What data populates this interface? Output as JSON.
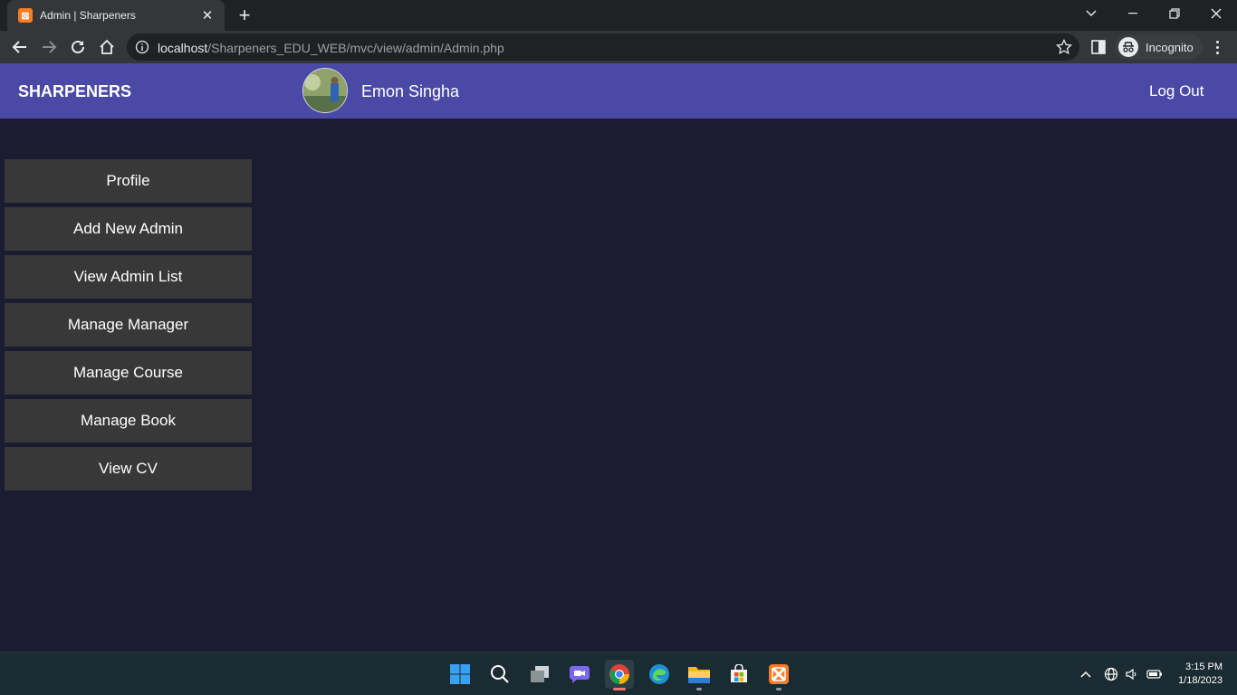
{
  "browser": {
    "tab_title": "Admin | Sharpeners",
    "tab_favicon": "xampp-icon",
    "url_host": "localhost",
    "url_path": "/Sharpeners_EDU_WEB/mvc/view/admin/Admin.php",
    "profile_label": "Incognito"
  },
  "header": {
    "brand": "SHARPENERS",
    "user_name": "Emon Singha",
    "logout_label": "Log Out",
    "background_color": "#4a4aa6"
  },
  "sidebar": {
    "items": [
      {
        "label": "Profile"
      },
      {
        "label": "Add New Admin"
      },
      {
        "label": "View Admin List"
      },
      {
        "label": "Manage Manager"
      },
      {
        "label": "Manage Course"
      },
      {
        "label": "Manage Book"
      },
      {
        "label": "View CV"
      }
    ]
  },
  "page": {
    "background_color": "#1b1c32"
  },
  "taskbar": {
    "time": "3:15 PM",
    "date": "1/18/2023",
    "apps": [
      "windows-start-icon",
      "search-icon",
      "task-view-icon",
      "chat-icon",
      "chrome-icon",
      "edge-icon",
      "file-explorer-icon",
      "store-icon",
      "xampp-icon"
    ]
  }
}
